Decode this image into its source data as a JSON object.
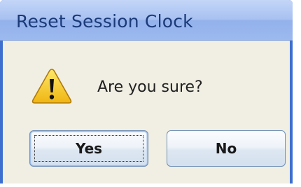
{
  "window": {
    "title": "Reset Session Clock"
  },
  "dialog": {
    "message": "Are you sure?",
    "icon": "warning-icon"
  },
  "buttons": {
    "yes_label": "Yes",
    "no_label": "No"
  },
  "colors": {
    "title_text": "#1b3a78",
    "titlebar": "#a8c1f1",
    "frame": "#3d6fcf",
    "client_bg": "#f1efe4",
    "warning_yellow": "#f6c81d"
  }
}
